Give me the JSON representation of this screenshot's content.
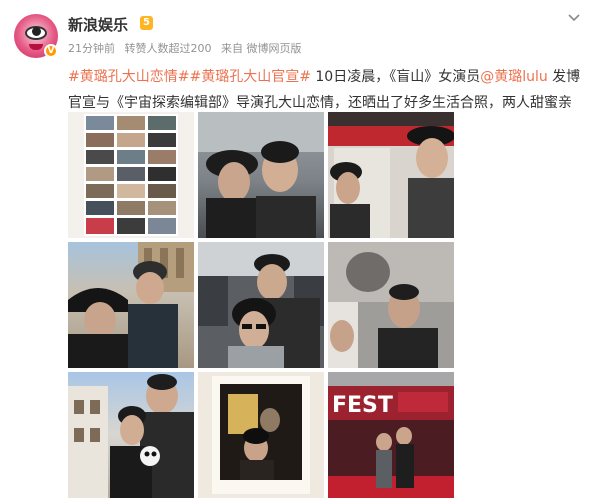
{
  "account": {
    "name": "新浪娱乐",
    "level": "5",
    "verified_mark": "V",
    "time": "21分钟前",
    "likes": "转赞人数超过200",
    "source": "来自 微博网页版"
  },
  "post": {
    "hashtag1": "#黄璐孔大山恋情#",
    "hashtag2": "#黄璐孔大山官宣#",
    "text1": " 10日凌晨，《盲山》女演员",
    "mention": "@黄璐lulu",
    "text2": " 发博官宣与《宇宙探索编辑部》导演孔大山恋情，还晒出了好多生活合照，两人甜蜜亲吻。恭喜！"
  },
  "photos": [
    {
      "label": "photo-collage"
    },
    {
      "label": "photo-kiss"
    },
    {
      "label": "photo-theater-selfie"
    },
    {
      "label": "photo-hats-outdoor"
    },
    {
      "label": "photo-train-selfie"
    },
    {
      "label": "photo-mirror-portrait"
    },
    {
      "label": "photo-street-panda"
    },
    {
      "label": "photo-polaroid"
    },
    {
      "label": "photo-film-fest",
      "sign_text": "FEST"
    }
  ],
  "icons": {
    "chevron": "chevron-down-icon"
  },
  "colors": {
    "link": "#eb7350",
    "text": "#333333",
    "meta": "#939393",
    "level": "#ffb422"
  }
}
